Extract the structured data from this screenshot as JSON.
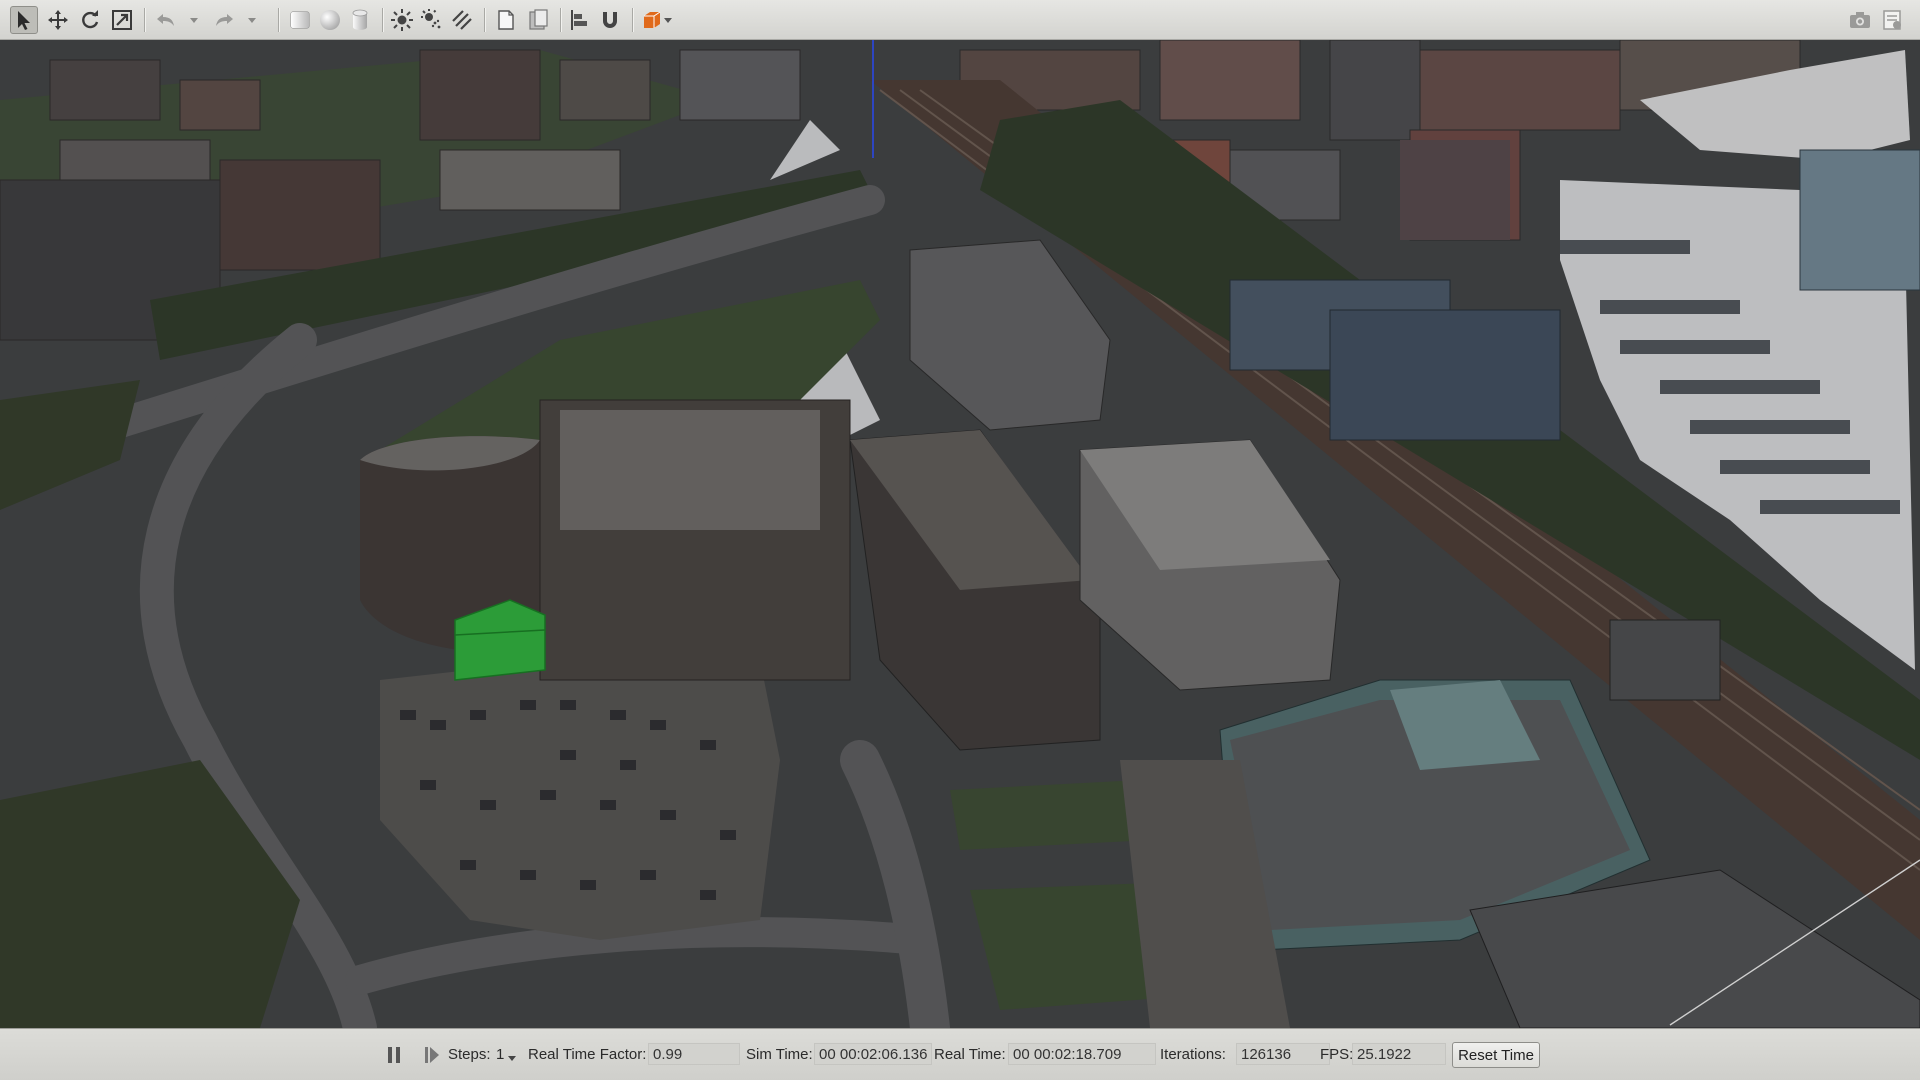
{
  "toolbar": {
    "tools": [
      {
        "icon": "select-arrow-icon",
        "active": true
      },
      {
        "icon": "translate-icon"
      },
      {
        "icon": "rotate-icon"
      },
      {
        "icon": "scale-icon"
      },
      {
        "icon": "undo-icon"
      },
      {
        "icon": "redo-icon"
      },
      {
        "icon": "box-icon"
      },
      {
        "icon": "sphere-icon"
      },
      {
        "icon": "cylinder-icon"
      },
      {
        "icon": "point-light-icon"
      },
      {
        "icon": "spot-light-icon"
      },
      {
        "icon": "directional-light-icon"
      },
      {
        "icon": "copy-icon"
      },
      {
        "icon": "paste-icon"
      },
      {
        "icon": "align-icon"
      },
      {
        "icon": "snap-icon"
      },
      {
        "icon": "view-angle-icon"
      },
      {
        "icon": "screenshot-icon"
      },
      {
        "icon": "log-icon"
      }
    ]
  },
  "status": {
    "steps_label": "Steps:",
    "steps_value": "1",
    "rtf_label": "Real Time Factor:",
    "rtf_value": "0.99",
    "sim_time_label": "Sim Time:",
    "sim_time_value": "00 00:02:06.136",
    "real_time_label": "Real Time:",
    "real_time_value": "00 00:02:18.709",
    "iterations_label": "Iterations:",
    "iterations_value": "126136",
    "fps_label": "FPS:",
    "fps_value": "25.1922",
    "reset_label": "Reset Time"
  },
  "colors": {
    "toolbar_bg": "#dcdcd8",
    "viewport_bg": "#3b3d40",
    "accent_orange": "#e06a1b",
    "highlight_green": "#2eae3c",
    "z_axis_blue": "#2f4bd8"
  }
}
